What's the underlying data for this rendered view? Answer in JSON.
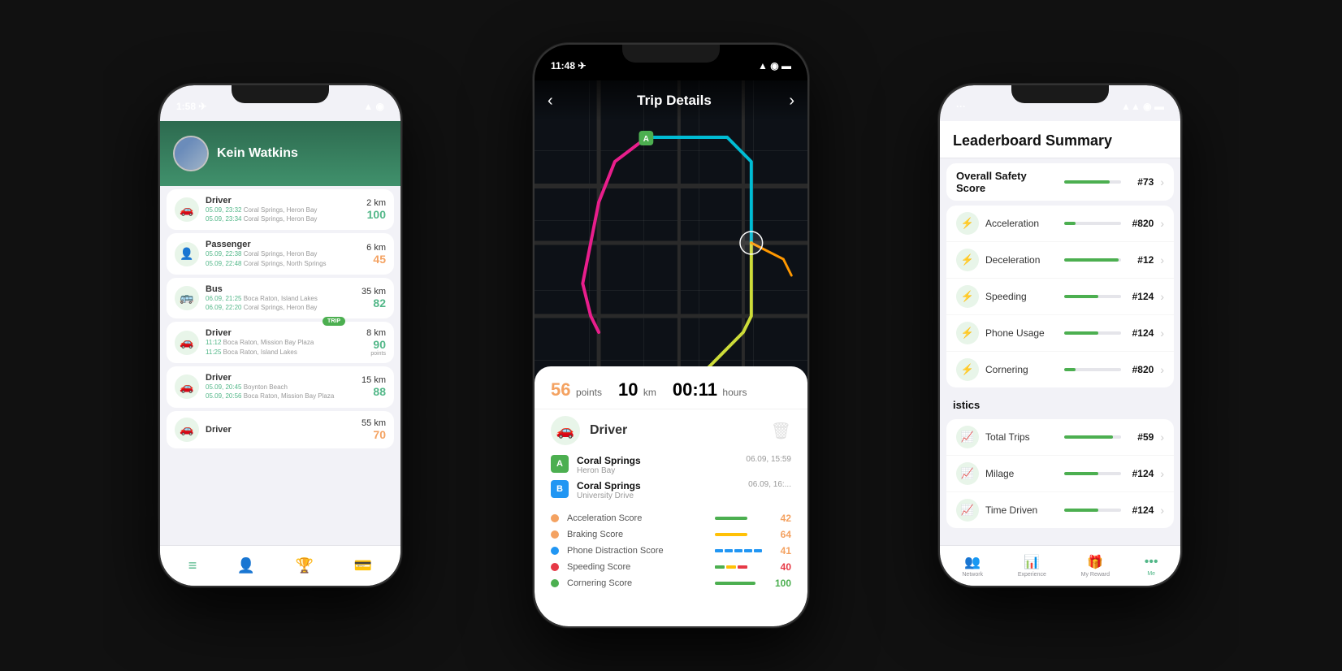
{
  "left_phone": {
    "status_time": "1:58 ✈",
    "user_name": "Kein Watkins",
    "trips": [
      {
        "type": "Driver",
        "km": "2 km",
        "score": "100",
        "score_color": "green",
        "date1": "05.09, 23:32",
        "place1": "Coral Springs, Heron Bay",
        "date2": "05.09, 23:34",
        "place2": "Coral Springs, Heron Bay"
      },
      {
        "type": "Passenger",
        "km": "6 km",
        "score": "45",
        "score_color": "orange",
        "date1": "05.09, 22:38",
        "place1": "Coral Springs, Heron Bay",
        "date2": "05.09, 22:48",
        "place2": "Coral Springs, North Springs"
      },
      {
        "type": "Bus",
        "km": "35 km",
        "score": "82",
        "score_color": "green",
        "date1": "06.09, 21:25",
        "place1": "Boca Raton, Island Lakes",
        "date2": "06.09, 22:20",
        "place2": "Coral Springs, Heron Bay"
      },
      {
        "type": "Driver",
        "km": "8 km",
        "score": "90",
        "score_label": "points",
        "score_color": "green",
        "date1": "11:12",
        "place1": "Boca Raton, Mission Bay Plaza",
        "date2": "11:25",
        "place2": "Boca Raton, Island Lakes"
      },
      {
        "type": "Driver",
        "km": "15 km",
        "score": "88",
        "score_color": "green",
        "date1": "05.09, 20:45",
        "place1": "Boynton Beach",
        "date2": "05.09, 20:56",
        "place2": "Boca Raton, Mission Bay Plaza"
      },
      {
        "type": "Driver",
        "km": "55 km",
        "score": "70",
        "score_color": "orange",
        "date1": "",
        "place1": "",
        "date2": "",
        "place2": ""
      }
    ],
    "nav": [
      "≡",
      "👤",
      "🏆",
      "💳"
    ]
  },
  "center_phone": {
    "status_time": "11:48 ✈",
    "title": "Trip Details",
    "map_label_back": "‹",
    "map_label_next": "›",
    "trip_points": "56",
    "trip_points_label": "points",
    "trip_km": "10",
    "trip_km_label": "km",
    "trip_time": "00:11",
    "trip_time_label": "hours",
    "mode": "Driver",
    "waypoints": [
      {
        "label": "A",
        "name": "Coral Springs",
        "sub_name": "Heron Bay",
        "time": "06.09, 15:59"
      },
      {
        "label": "B",
        "name": "Coral Springs",
        "sub_name": "University Drive",
        "time": "06.09, 16:..."
      }
    ],
    "scores": [
      {
        "name": "Acceleration Score",
        "value": "42",
        "color": "#f4a261",
        "bar_type": "solid_green",
        "color_class": "orange"
      },
      {
        "name": "Braking Score",
        "value": "64",
        "color": "#f4a261",
        "bar_type": "solid_yellow",
        "color_class": "orange"
      },
      {
        "name": "Phone Distraction Score",
        "value": "41",
        "color": "#2196F3",
        "bar_type": "blue_bars",
        "color_class": "orange"
      },
      {
        "name": "Speeding Score",
        "value": "40",
        "color": "#e63946",
        "bar_type": "mixed_bars",
        "color_class": "red"
      },
      {
        "name": "Cornering Score",
        "value": "100",
        "color": "#4CAF50",
        "bar_type": "solid_green_full",
        "color_class": "green"
      }
    ]
  },
  "right_phone": {
    "status_time": "...",
    "title": "Leaderboard Summary",
    "overall": {
      "label": "Overall Safety Score",
      "rank": "#73",
      "bar_pct": 80
    },
    "categories": [
      {
        "name": "Acceleration",
        "rank": "#820",
        "bar_pct": 20
      },
      {
        "name": "Deceleration",
        "rank": "#12",
        "bar_pct": 95
      },
      {
        "name": "Speeding",
        "rank": "#124",
        "bar_pct": 60
      },
      {
        "name": "Phone Usage",
        "rank": "#124",
        "bar_pct": 60
      },
      {
        "name": "Cornering",
        "rank": "#820",
        "bar_pct": 20
      }
    ],
    "statistics_label": "istics",
    "stats": [
      {
        "name": "Total Trips",
        "rank": "#59",
        "bar_pct": 85
      },
      {
        "name": "Milage",
        "rank": "#124",
        "bar_pct": 60
      },
      {
        "name": "Time Driven",
        "rank": "#124",
        "bar_pct": 60
      }
    ],
    "nav": [
      {
        "icon": "👥",
        "label": "Network"
      },
      {
        "icon": "📊",
        "label": "Experience"
      },
      {
        "icon": "🎁",
        "label": "My Reward"
      },
      {
        "icon": "•••",
        "label": "Me"
      }
    ]
  }
}
